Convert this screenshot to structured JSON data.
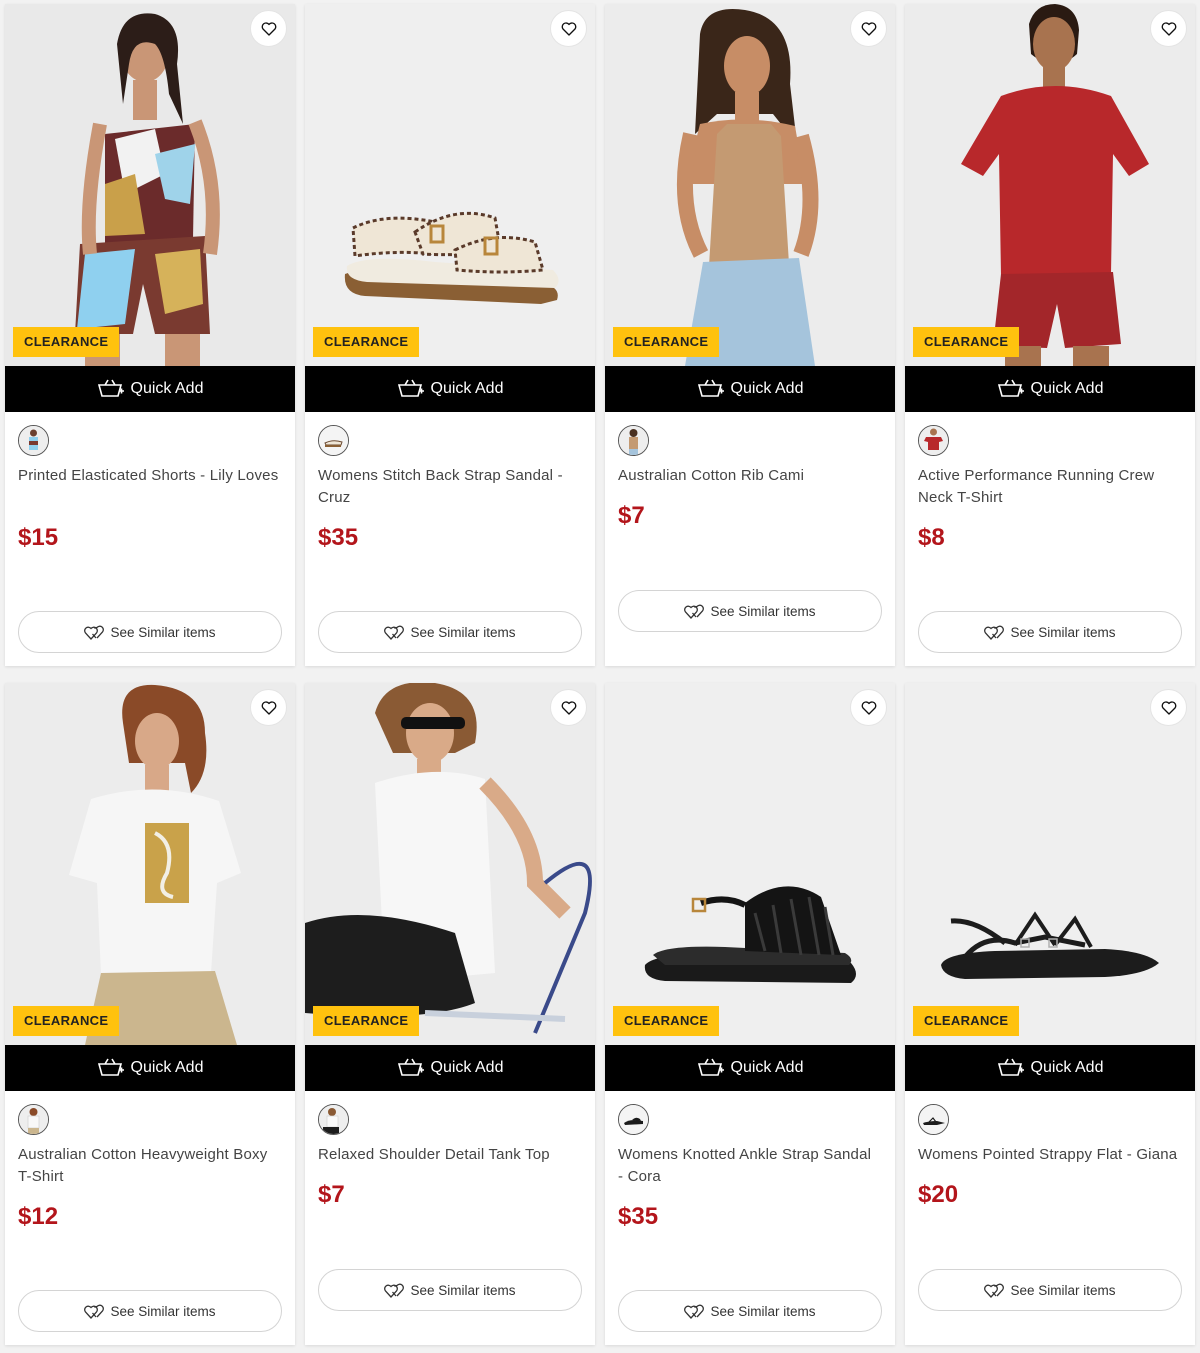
{
  "ui": {
    "badge": "CLEARANCE",
    "quick_add": "Quick Add",
    "see_similar": "See Similar items",
    "colors": {
      "badge": "#ffc20e",
      "quick_add_bg": "#000000",
      "price": "#b3151b"
    },
    "icons": {
      "wishlist": "heart-icon",
      "quick_add": "basket-icon",
      "similar": "hearts-icon"
    }
  },
  "products": [
    {
      "name": "Printed Elasticated Shorts - Lily Loves",
      "price": "$15"
    },
    {
      "name": "Womens Stitch Back Strap Sandal - Cruz",
      "price": "$35"
    },
    {
      "name": "Australian Cotton Rib Cami",
      "price": "$7"
    },
    {
      "name": "Active Performance Running Crew Neck T-Shirt",
      "price": "$8"
    },
    {
      "name": "Australian Cotton Heavyweight Boxy T-Shirt",
      "price": "$12"
    },
    {
      "name": "Relaxed Shoulder Detail Tank Top",
      "price": "$7"
    },
    {
      "name": "Womens Knotted Ankle Strap Sandal - Cora",
      "price": "$35"
    },
    {
      "name": "Womens Pointed Strappy Flat - Giana",
      "price": "$20"
    }
  ]
}
